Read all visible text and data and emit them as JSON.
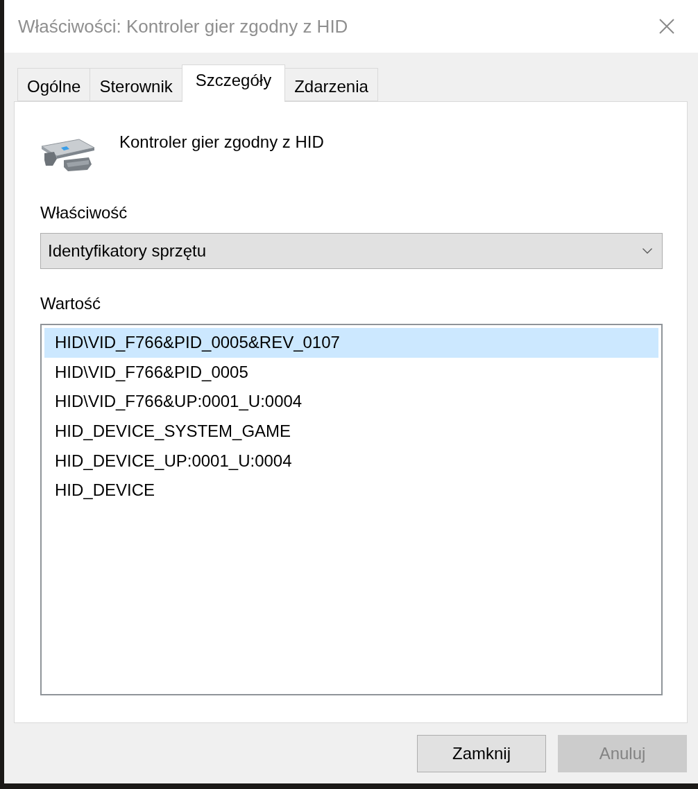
{
  "window": {
    "title": "Właściwości: Kontroler gier zgodny z HID"
  },
  "tabs": [
    {
      "label": "Ogólne",
      "selected": false
    },
    {
      "label": "Sterownik",
      "selected": false
    },
    {
      "label": "Szczegóły",
      "selected": true
    },
    {
      "label": "Zdarzenia",
      "selected": false
    }
  ],
  "device": {
    "name": "Kontroler gier zgodny z HID"
  },
  "property": {
    "label": "Właściwość",
    "value": "Identyfikatory sprzętu"
  },
  "values": {
    "label": "Wartość",
    "items": [
      {
        "text": "HID\\VID_F766&PID_0005&REV_0107",
        "selected": true
      },
      {
        "text": "HID\\VID_F766&PID_0005",
        "selected": false
      },
      {
        "text": "HID\\VID_F766&UP:0001_U:0004",
        "selected": false
      },
      {
        "text": "HID_DEVICE_SYSTEM_GAME",
        "selected": false
      },
      {
        "text": "HID_DEVICE_UP:0001_U:0004",
        "selected": false
      },
      {
        "text": "HID_DEVICE",
        "selected": false
      }
    ]
  },
  "buttons": [
    {
      "label": "Zamknij",
      "disabled": false
    },
    {
      "label": "Anuluj",
      "disabled": true
    }
  ]
}
